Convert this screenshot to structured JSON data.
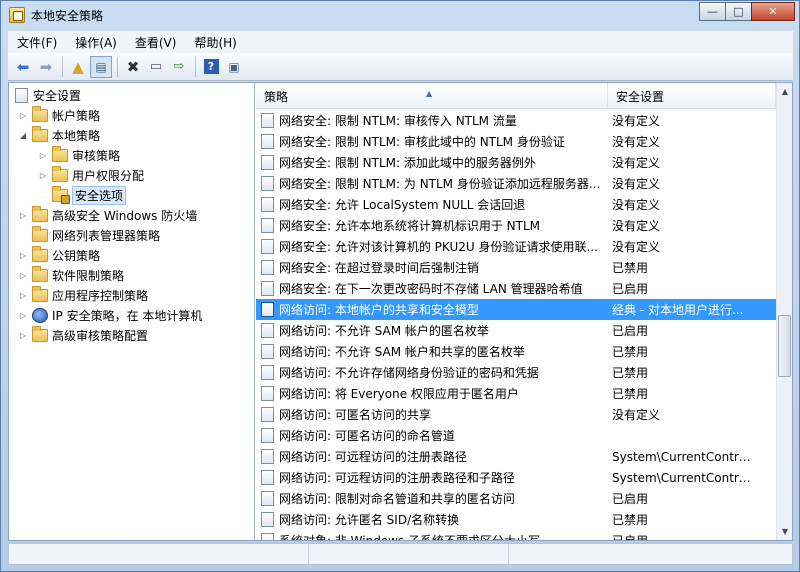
{
  "window": {
    "title": "本地安全策略",
    "controls": {
      "minimize": "—",
      "maximize": "□",
      "close": "✕"
    }
  },
  "menu": [
    "文件(F)",
    "操作(A)",
    "查看(V)",
    "帮助(H)"
  ],
  "toolbar": {
    "back_icon": "arrow-left-icon",
    "forward_icon": "arrow-right-icon",
    "up_icon": "folder-up-icon",
    "show_tree_icon": "console-tree-icon",
    "delete_icon": "delete-icon",
    "properties_icon": "properties-icon",
    "export_icon": "export-list-icon",
    "help_icon": "help-icon",
    "view_icon": "view-icon"
  },
  "tree": {
    "root": "安全设置",
    "account_policy": "帐户策略",
    "local_policy": "本地策略",
    "audit_policy": "审核策略",
    "user_rights": "用户权限分配",
    "security_options": "安全选项",
    "firewall": "高级安全 Windows 防火墙",
    "network_list": "网络列表管理器策略",
    "public_key": "公钥策略",
    "software_restriction": "软件限制策略",
    "app_control": "应用程序控制策略",
    "ipsec": "IP 安全策略，在 本地计算机",
    "advanced_audit": "高级审核策略配置"
  },
  "list": {
    "columns": {
      "policy": "策略",
      "setting": "安全设置"
    },
    "rows": [
      {
        "policy": "网络安全: 限制 NTLM: 审核传入 NTLM 流量",
        "setting": "没有定义"
      },
      {
        "policy": "网络安全: 限制 NTLM: 审核此域中的 NTLM 身份验证",
        "setting": "没有定义"
      },
      {
        "policy": "网络安全: 限制 NTLM: 添加此域中的服务器例外",
        "setting": "没有定义"
      },
      {
        "policy": "网络安全: 限制 NTLM: 为 NTLM 身份验证添加远程服务器...",
        "setting": "没有定义"
      },
      {
        "policy": "网络安全: 允许 LocalSystem NULL 会话回退",
        "setting": "没有定义"
      },
      {
        "policy": "网络安全: 允许本地系统将计算机标识用于 NTLM",
        "setting": "没有定义"
      },
      {
        "policy": "网络安全: 允许对该计算机的 PKU2U 身份验证请求使用联...",
        "setting": "没有定义"
      },
      {
        "policy": "网络安全: 在超过登录时间后强制注销",
        "setting": "已禁用"
      },
      {
        "policy": "网络安全: 在下一次更改密码时不存储 LAN 管理器哈希值",
        "setting": "已启用"
      },
      {
        "policy": "网络访问: 本地帐户的共享和安全模型",
        "setting": "经典 - 对本地用户进行..."
      },
      {
        "policy": "网络访问: 不允许 SAM 帐户的匿名枚举",
        "setting": "已启用"
      },
      {
        "policy": "网络访问: 不允许 SAM 帐户和共享的匿名枚举",
        "setting": "已禁用"
      },
      {
        "policy": "网络访问: 不允许存储网络身份验证的密码和凭据",
        "setting": "已禁用"
      },
      {
        "policy": "网络访问: 将 Everyone 权限应用于匿名用户",
        "setting": "已禁用"
      },
      {
        "policy": "网络访问: 可匿名访问的共享",
        "setting": "没有定义"
      },
      {
        "policy": "网络访问: 可匿名访问的命名管道",
        "setting": ""
      },
      {
        "policy": "网络访问: 可远程访问的注册表路径",
        "setting": "System\\CurrentContro..."
      },
      {
        "policy": "网络访问: 可远程访问的注册表路径和子路径",
        "setting": "System\\CurrentContro..."
      },
      {
        "policy": "网络访问: 限制对命名管道和共享的匿名访问",
        "setting": "已启用"
      },
      {
        "policy": "网络访问: 允许匿名 SID/名称转换",
        "setting": "已禁用"
      },
      {
        "policy": "系统对象: 非 Windows 子系统不要求区分大小写",
        "setting": "已启用"
      }
    ]
  }
}
